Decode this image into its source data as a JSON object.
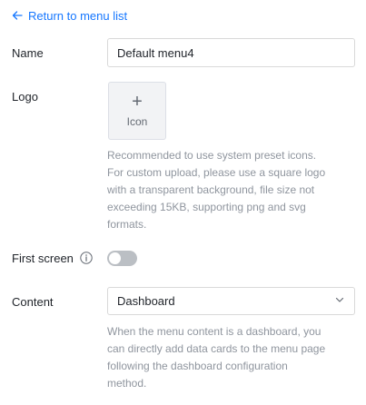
{
  "header": {
    "back_label": "Return to menu list"
  },
  "form": {
    "name": {
      "label": "Name",
      "value": "Default menu4"
    },
    "logo": {
      "label": "Logo",
      "upload_label": "Icon",
      "help_lines": [
        "Recommended to use system preset icons.",
        "For custom upload, please use a square logo",
        "with a transparent background, file size not",
        "exceeding 15KB, supporting png and svg",
        "formats."
      ]
    },
    "first_screen": {
      "label": "First screen",
      "enabled": false
    },
    "content": {
      "label": "Content",
      "selected": "Dashboard",
      "help_lines": [
        "When the menu content is a dashboard, you",
        "can directly add data cards to the menu page",
        "following the dashboard configuration",
        "method."
      ]
    }
  },
  "colors": {
    "accent": "#1677ff",
    "muted_text": "#8f959e",
    "switch_off": "#bbbfc4"
  },
  "icons": {
    "back": "arrow-left-icon",
    "info": "info-circle-icon",
    "dropdown": "chevron-down-icon",
    "upload": "plus-icon"
  }
}
